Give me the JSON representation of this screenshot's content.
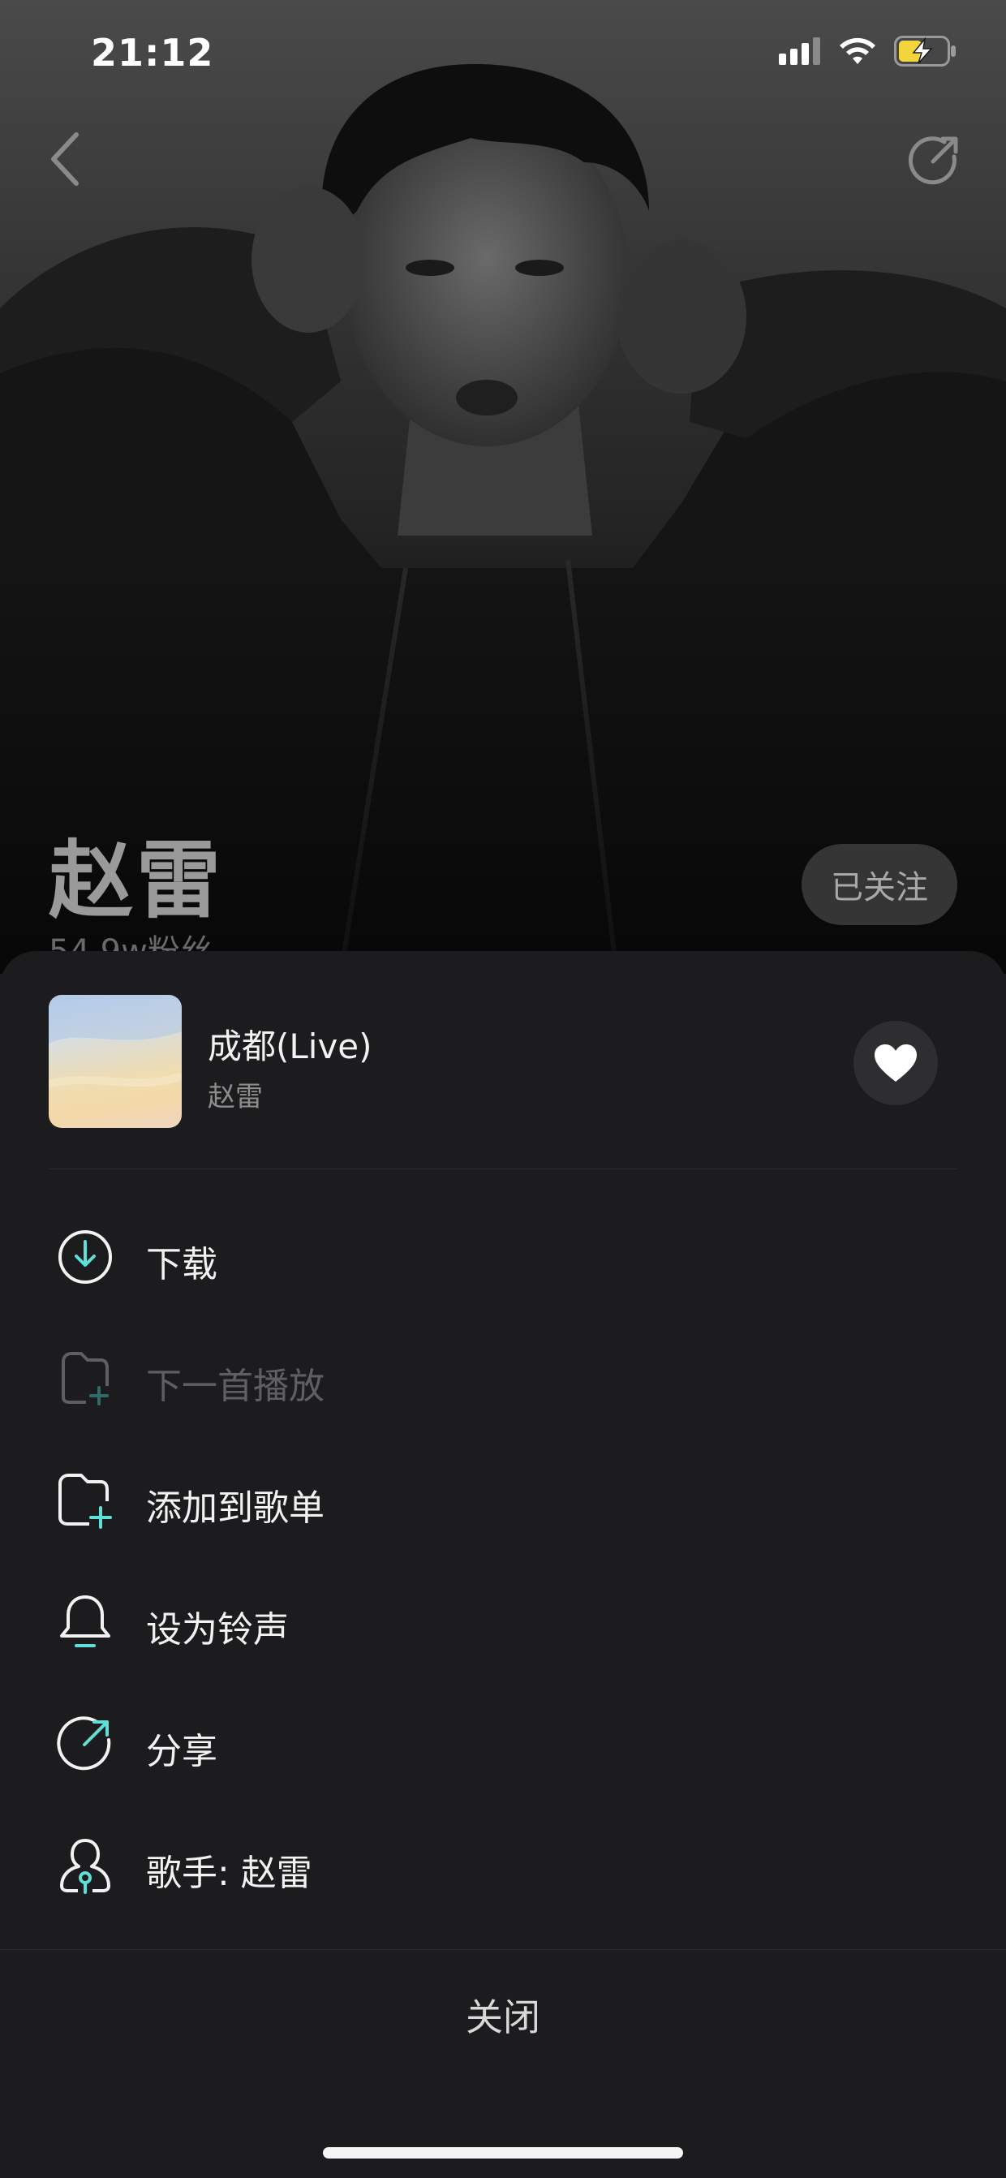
{
  "status_bar": {
    "time": "21:12"
  },
  "artist": {
    "name": "赵雷",
    "fans": "54.9w粉丝",
    "follow_label": "已关注"
  },
  "song": {
    "title": "成都(Live)",
    "artist": "赵雷"
  },
  "menu": {
    "items": [
      {
        "label": "下载",
        "icon": "download-icon",
        "enabled": true
      },
      {
        "label": "下一首播放",
        "icon": "play-next-icon",
        "enabled": false
      },
      {
        "label": "添加到歌单",
        "icon": "add-to-playlist-icon",
        "enabled": true
      },
      {
        "label": "设为铃声",
        "icon": "bell-icon",
        "enabled": true
      },
      {
        "label": "分享",
        "icon": "share-icon",
        "enabled": true
      },
      {
        "label": "歌手:  赵雷",
        "icon": "singer-icon",
        "enabled": true
      }
    ]
  },
  "close_label": "关闭",
  "colors": {
    "accent": "#5ee0d8",
    "sheet_bg": "#1c1c1e",
    "battery": "#f2d53c"
  }
}
